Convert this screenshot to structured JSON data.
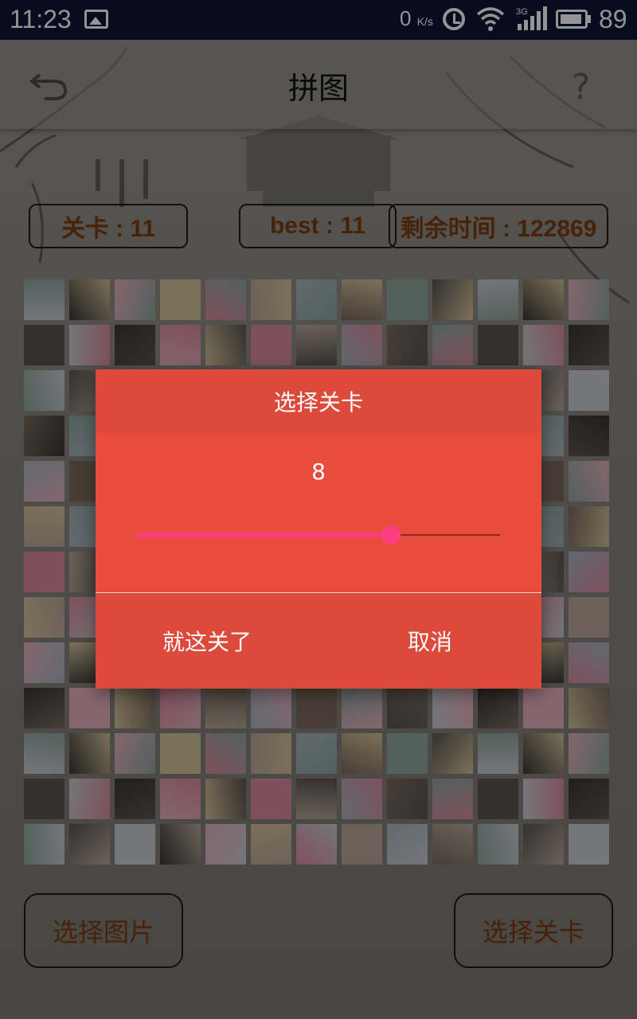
{
  "status_bar": {
    "time": "11:23",
    "net_speed_value": "0",
    "net_speed_unit": "K/s",
    "network_type": "3G",
    "battery": "89",
    "icons": [
      "image-icon",
      "alarm-icon",
      "wifi-icon",
      "signal-icon",
      "battery-icon"
    ]
  },
  "header": {
    "title": "拼图",
    "icons": [
      "back-icon",
      "help-icon"
    ]
  },
  "stats": {
    "level": "关卡 : 11",
    "best": "best : 11",
    "time_left": "剩余时间 : 122869"
  },
  "puzzle": {
    "rows": 13,
    "cols": 13
  },
  "buttons": {
    "choose_image": "选择图片",
    "choose_level": "选择关卡"
  },
  "dialog": {
    "title": "选择关卡",
    "value": "8",
    "slider_fraction": 0.7,
    "confirm_label": "就这关了",
    "cancel_label": "取消"
  },
  "colors": {
    "status_bar": "#0d1536",
    "dialog_body": "#e84c3d",
    "dialog_header": "#db4a3b",
    "slider_accent": "#ff3d7f",
    "stat_text": "#7a3c10"
  }
}
